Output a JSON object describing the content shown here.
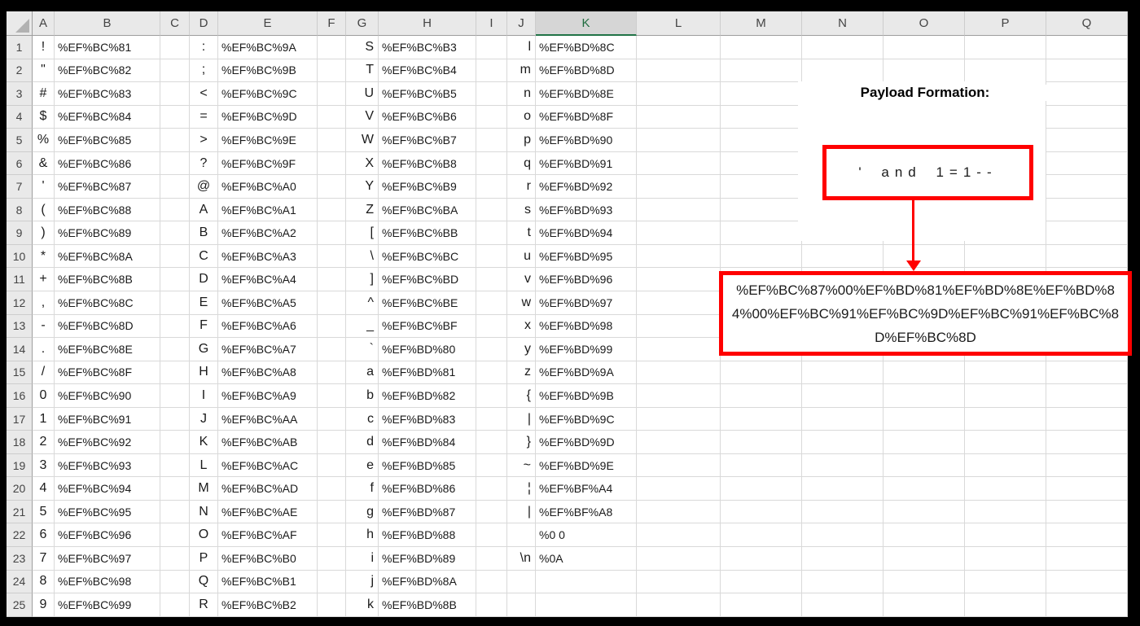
{
  "colors": {
    "frame_black": "#000000",
    "accent_green": "#217346",
    "box_red": "#ff0000",
    "header_bg": "#e9e9e9",
    "selected_header_bg": "#d6d6d6",
    "gridline": "#d9d9d9"
  },
  "sheet": {
    "column_headers": [
      "A",
      "B",
      "C",
      "D",
      "E",
      "F",
      "G",
      "H",
      "I",
      "J",
      "K",
      "L",
      "M",
      "N",
      "O",
      "P",
      "Q"
    ],
    "selected_column": "K",
    "row_headers": [
      1,
      2,
      3,
      4,
      5,
      6,
      7,
      8,
      9,
      10,
      11,
      12,
      13,
      14,
      15,
      16,
      17,
      18,
      19,
      20,
      21,
      22,
      23,
      24,
      25
    ],
    "rows": [
      {
        "A": "!",
        "B": "%EF%BC%81",
        "D": ":",
        "E": "%EF%BC%9A",
        "G": "S",
        "H": "%EF%BC%B3",
        "J": "l",
        "K": "%EF%BD%8C"
      },
      {
        "A": "\"",
        "B": "%EF%BC%82",
        "D": ";",
        "E": "%EF%BC%9B",
        "G": "T",
        "H": "%EF%BC%B4",
        "J": "m",
        "K": "%EF%BD%8D"
      },
      {
        "A": "#",
        "B": "%EF%BC%83",
        "D": "<",
        "E": "%EF%BC%9C",
        "G": "U",
        "H": "%EF%BC%B5",
        "J": "n",
        "K": "%EF%BD%8E"
      },
      {
        "A": "$",
        "B": "%EF%BC%84",
        "D": "=",
        "E": "%EF%BC%9D",
        "G": "V",
        "H": "%EF%BC%B6",
        "J": "o",
        "K": "%EF%BD%8F"
      },
      {
        "A": "%",
        "B": "%EF%BC%85",
        "D": ">",
        "E": "%EF%BC%9E",
        "G": "W",
        "H": "%EF%BC%B7",
        "J": "p",
        "K": "%EF%BD%90"
      },
      {
        "A": "&",
        "B": "%EF%BC%86",
        "D": "?",
        "E": "%EF%BC%9F",
        "G": "X",
        "H": "%EF%BC%B8",
        "J": "q",
        "K": "%EF%BD%91"
      },
      {
        "A": "'",
        "B": "%EF%BC%87",
        "D": "@",
        "E": "%EF%BC%A0",
        "G": "Y",
        "H": "%EF%BC%B9",
        "J": "r",
        "K": "%EF%BD%92"
      },
      {
        "A": "(",
        "B": "%EF%BC%88",
        "D": "A",
        "E": "%EF%BC%A1",
        "G": "Z",
        "H": "%EF%BC%BA",
        "J": "s",
        "K": "%EF%BD%93"
      },
      {
        "A": ")",
        "B": "%EF%BC%89",
        "D": "B",
        "E": "%EF%BC%A2",
        "G": "[",
        "H": "%EF%BC%BB",
        "J": "t",
        "K": "%EF%BD%94"
      },
      {
        "A": "*",
        "B": "%EF%BC%8A",
        "D": "C",
        "E": "%EF%BC%A3",
        "G": "\\",
        "H": "%EF%BC%BC",
        "J": "u",
        "K": "%EF%BD%95"
      },
      {
        "A": "+",
        "B": "%EF%BC%8B",
        "D": "D",
        "E": "%EF%BC%A4",
        "G": "]",
        "H": "%EF%BC%BD",
        "J": "v",
        "K": "%EF%BD%96"
      },
      {
        "A": ",",
        "B": "%EF%BC%8C",
        "D": "E",
        "E": "%EF%BC%A5",
        "G": "^",
        "H": "%EF%BC%BE",
        "J": "w",
        "K": "%EF%BD%97"
      },
      {
        "A": "-",
        "B": "%EF%BC%8D",
        "D": "F",
        "E": "%EF%BC%A6",
        "G": "_",
        "H": "%EF%BC%BF",
        "J": "x",
        "K": "%EF%BD%98"
      },
      {
        "A": ".",
        "B": "%EF%BC%8E",
        "D": "G",
        "E": "%EF%BC%A7",
        "G": "`",
        "H": "%EF%BD%80",
        "J": "y",
        "K": "%EF%BD%99"
      },
      {
        "A": "/",
        "B": "%EF%BC%8F",
        "D": "H",
        "E": "%EF%BC%A8",
        "G": "a",
        "H": "%EF%BD%81",
        "J": "z",
        "K": "%EF%BD%9A"
      },
      {
        "A": "0",
        "B": "%EF%BC%90",
        "D": "I",
        "E": "%EF%BC%A9",
        "G": "b",
        "H": "%EF%BD%82",
        "J": "{",
        "K": "%EF%BD%9B"
      },
      {
        "A": "1",
        "B": "%EF%BC%91",
        "D": "J",
        "E": "%EF%BC%AA",
        "G": "c",
        "H": "%EF%BD%83",
        "J": "|",
        "K": "%EF%BD%9C"
      },
      {
        "A": "2",
        "B": "%EF%BC%92",
        "D": "K",
        "E": "%EF%BC%AB",
        "G": "d",
        "H": "%EF%BD%84",
        "J": "}",
        "K": "%EF%BD%9D"
      },
      {
        "A": "3",
        "B": "%EF%BC%93",
        "D": "L",
        "E": "%EF%BC%AC",
        "G": "e",
        "H": "%EF%BD%85",
        "J": "~",
        "K": "%EF%BD%9E"
      },
      {
        "A": "4",
        "B": "%EF%BC%94",
        "D": "M",
        "E": "%EF%BC%AD",
        "G": "f",
        "H": "%EF%BD%86",
        "J": "¦",
        "K": "%EF%BF%A4"
      },
      {
        "A": "5",
        "B": "%EF%BC%95",
        "D": "N",
        "E": "%EF%BC%AE",
        "G": "g",
        "H": "%EF%BD%87",
        "J": "|",
        "K": "%EF%BF%A8"
      },
      {
        "A": "6",
        "B": "%EF%BC%96",
        "D": "O",
        "E": "%EF%BC%AF",
        "G": "h",
        "H": "%EF%BD%88",
        "J": "",
        "K": "%0 0"
      },
      {
        "A": "7",
        "B": "%EF%BC%97",
        "D": "P",
        "E": "%EF%BC%B0",
        "G": "i",
        "H": "%EF%BD%89",
        "J": "\\n",
        "K": "%0A"
      },
      {
        "A": "8",
        "B": "%EF%BC%98",
        "D": "Q",
        "E": "%EF%BC%B1",
        "G": "j",
        "H": "%EF%BD%8A",
        "J": "",
        "K": ""
      },
      {
        "A": "9",
        "B": "%EF%BC%99",
        "D": "R",
        "E": "%EF%BC%B2",
        "G": "k",
        "H": "%EF%BD%8B",
        "J": "",
        "K": ""
      }
    ]
  },
  "annotation": {
    "title": "Payload Formation:",
    "payload_plain": "' and 1=1--",
    "payload_encoded": "%EF%BC%87%00%EF%BD%81%EF%BD%8E%EF%BD%84%00%EF%BC%91%EF%BC%9D%EF%BC%91%EF%BC%8D%EF%BC%8D"
  }
}
